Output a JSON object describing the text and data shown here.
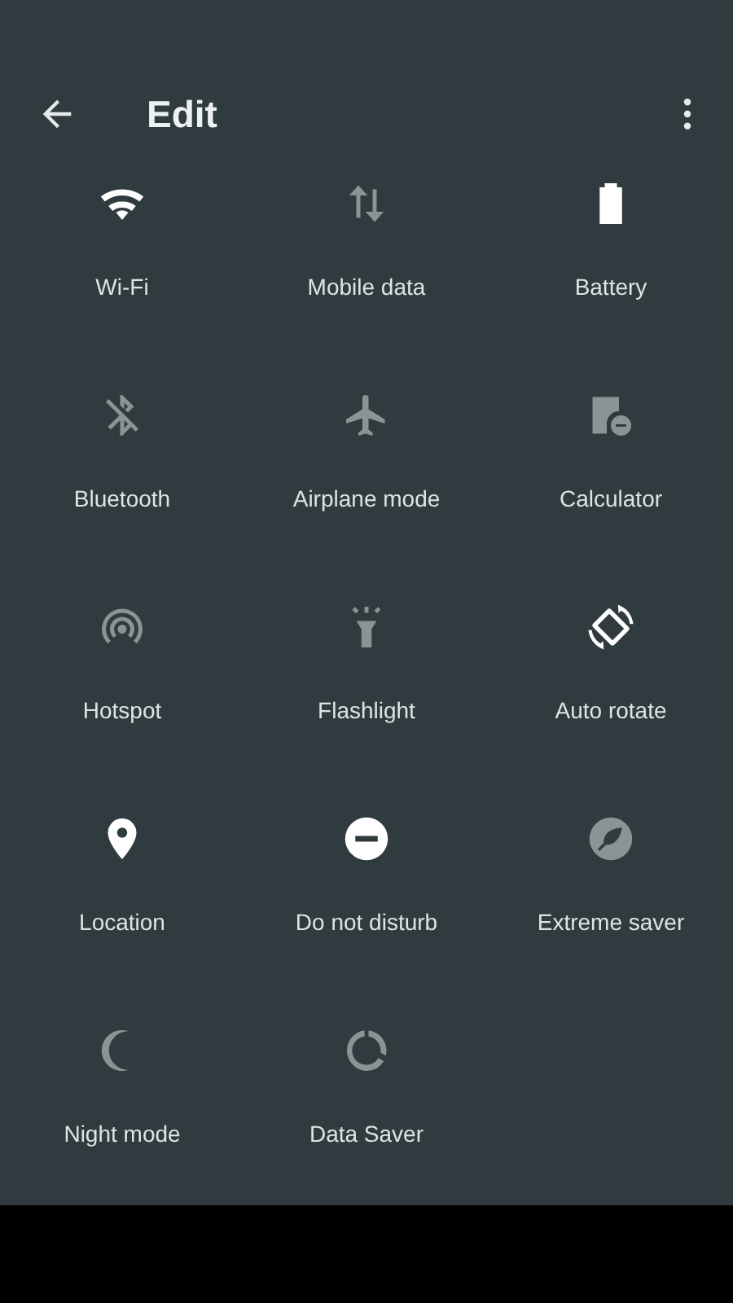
{
  "header": {
    "title": "Edit"
  },
  "tiles": [
    {
      "label": "Wi-Fi",
      "on": true
    },
    {
      "label": "Mobile data",
      "on": false
    },
    {
      "label": "Battery",
      "on": true
    },
    {
      "label": "Bluetooth",
      "on": false
    },
    {
      "label": "Airplane mode",
      "on": false
    },
    {
      "label": "Calculator",
      "on": false
    },
    {
      "label": "Hotspot",
      "on": false
    },
    {
      "label": "Flashlight",
      "on": false
    },
    {
      "label": "Auto rotate",
      "on": true
    },
    {
      "label": "Location",
      "on": true
    },
    {
      "label": "Do not disturb",
      "on": true
    },
    {
      "label": "Extreme saver",
      "on": false
    },
    {
      "label": "Night mode",
      "on": false
    },
    {
      "label": "Data Saver",
      "on": false
    }
  ]
}
